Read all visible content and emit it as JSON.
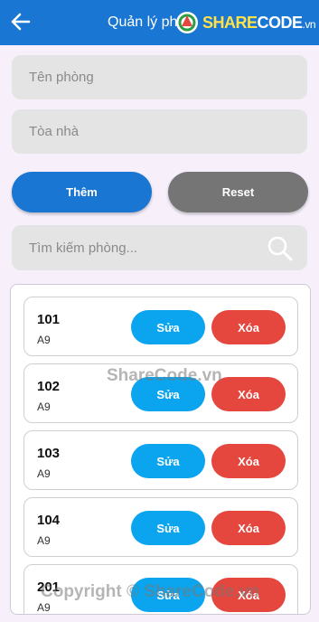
{
  "appbar": {
    "title": "Quản lý ph",
    "logo_prefix": "SHARE",
    "logo_suffix": "CODE",
    "logo_tld": ".vn",
    "color": "#1976d2"
  },
  "form": {
    "room_name_placeholder": "Tên phòng",
    "building_placeholder": "Tòa nhà",
    "add_label": "Thêm",
    "reset_label": "Reset"
  },
  "search": {
    "placeholder": "Tìm kiếm phòng..."
  },
  "rooms": [
    {
      "name": "101",
      "building": "A9",
      "edit_label": "Sửa",
      "delete_label": "Xóa"
    },
    {
      "name": "102",
      "building": "A9",
      "edit_label": "Sửa",
      "delete_label": "Xóa"
    },
    {
      "name": "103",
      "building": "A9",
      "edit_label": "Sửa",
      "delete_label": "Xóa"
    },
    {
      "name": "104",
      "building": "A9",
      "edit_label": "Sửa",
      "delete_label": "Xóa"
    },
    {
      "name": "201",
      "building": "A9",
      "edit_label": "Sửa",
      "delete_label": "Xóa"
    }
  ],
  "watermarks": {
    "middle": "ShareCode.vn",
    "bottom": "Copyright © ShareCode.vn"
  },
  "colors": {
    "primary": "#1976d2",
    "reset": "#757575",
    "edit": "#0aa5ee",
    "delete": "#e5463e"
  }
}
